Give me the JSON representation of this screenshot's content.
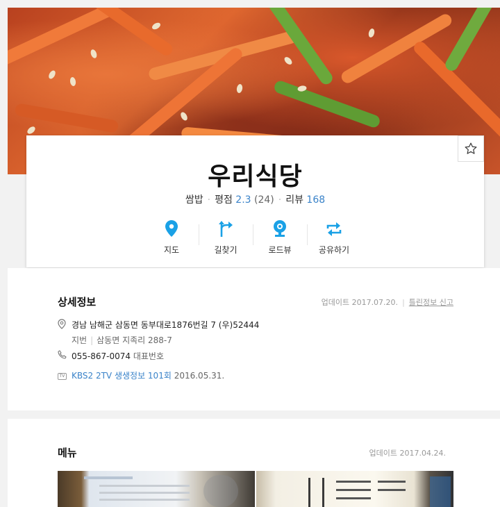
{
  "restaurant": {
    "name": "우리식당",
    "category": "쌈밥",
    "rating_label": "평점",
    "rating_value": "2.3",
    "rating_count": "(24)",
    "review_label": "리뷰",
    "review_count": "168"
  },
  "actions": [
    {
      "label": "지도",
      "icon": "map-pin-icon"
    },
    {
      "label": "길찾기",
      "icon": "directions-icon"
    },
    {
      "label": "로드뷰",
      "icon": "roadview-icon"
    },
    {
      "label": "공유하기",
      "icon": "share-icon"
    }
  ],
  "detail": {
    "title": "상세정보",
    "updated": "업데이트 2017.07.20.",
    "report_link": "틀린정보 신고",
    "address": "경남 남해군 삼동면 동부대로1876번길 7 (우)52444",
    "lot_label": "지번",
    "lot_address": "삼동면 지족리 288-7",
    "phone": "055-867-0074",
    "phone_label": "대표번호",
    "tv_program": "KBS2 2TV 생생정보 101회",
    "tv_date": "2016.05.31."
  },
  "menu": {
    "title": "메뉴",
    "updated": "업데이트 2017.04.24."
  },
  "colors": {
    "accent_blue": "#3a83c9",
    "icon_blue": "#1aa1e6"
  }
}
